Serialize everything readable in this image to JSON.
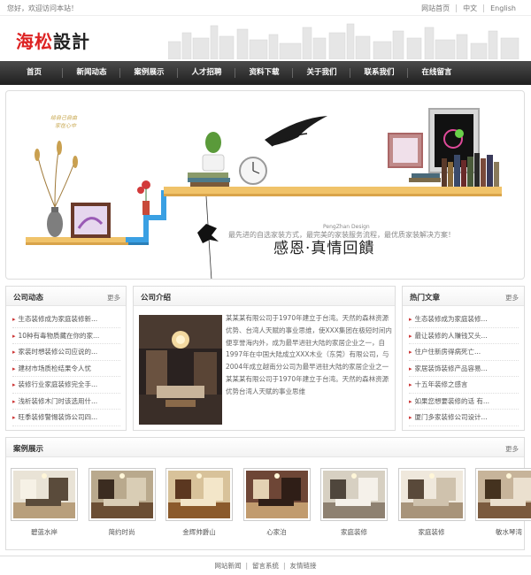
{
  "topbar": {
    "greeting": "您好，欢迎访问本站！",
    "links": [
      "网站首页",
      "中文",
      "English"
    ]
  },
  "logo": {
    "part1": "海松",
    "part2": "設計"
  },
  "nav": [
    "首页",
    "新闻动态",
    "案例展示",
    "人才招聘",
    "资料下载",
    "关于我们",
    "联系我们",
    "在线留言"
  ],
  "banner": {
    "slogan": "感恩·真情回饋",
    "slogan_en": "PengZhan Design",
    "tagline": "最先进的自选家装方式，最完美的家装服务流程，最优质家装解决方案！",
    "small_line1": "给自己自由",
    "small_line2": "家在心中"
  },
  "news": {
    "title": "公司动态",
    "more": "更多",
    "items": [
      "生态装修成为家庭装修新...",
      "10种有毒物质藏在你的家...",
      "家装时想装修公司应说的...",
      "建材市场质检结果令人忧",
      "装修行业家庭装修完全手...",
      "浅析装修木门时该选用什...",
      "旺季装修警惕装饰公司四..."
    ]
  },
  "about": {
    "title": "公司介绍",
    "text": "某某某有限公司于1970年建立于台湾。天然的森林资源优势、台湾人天赋的事业思维，使XXX集团在极短时间内便享誉海内外，成为最早进驻大陆的家居企业之一，自1997年在中国大陆成立XXX木业（东莞）有限公司，与2004年成立越南分公司为最早进驻大陆的家居企业之一某某某有限公司于1970年建立于台湾。天然的森林资源优势台湾人天赋的事业思维"
  },
  "hot": {
    "title": "热门文章",
    "more": "更多",
    "items": [
      "生态装修成为家庭装修...",
      "最让装修的人赚钱又头...",
      "住户住新房得病死亡...",
      "家居装饰装修产品容易...",
      "十五年装修之感言",
      "如果您想要装修的话 有...",
      "厦门多家装修公司设计..."
    ]
  },
  "cases": {
    "title": "案例展示",
    "more": "更多",
    "items": [
      {
        "caption": "碧蓝水岸",
        "palette": [
          "#e9e3d6",
          "#b89f7c",
          "#5a4b3b",
          "#f6f1e6"
        ]
      },
      {
        "caption": "简约时尚",
        "palette": [
          "#b9a98d",
          "#6b4e34",
          "#d9cdb5",
          "#3b2c20"
        ]
      },
      {
        "caption": "金辉帅爵山",
        "palette": [
          "#d8c29a",
          "#8b5a2b",
          "#f3e6c9",
          "#5b3720"
        ]
      },
      {
        "caption": "心家泊",
        "palette": [
          "#6e4636",
          "#c19b6e",
          "#2f1e17",
          "#e4d2b3"
        ]
      },
      {
        "caption": "家庭装修",
        "palette": [
          "#d7d0c2",
          "#8e8171",
          "#f5f1ea",
          "#4f463c"
        ]
      },
      {
        "caption": "家庭装修",
        "palette": [
          "#efe8dc",
          "#a8947a",
          "#cfc2ad",
          "#59493a"
        ]
      },
      {
        "caption": "敏水琴湾",
        "palette": [
          "#c7b49a",
          "#7b5a3e",
          "#ebe0cf",
          "#44321f"
        ]
      }
    ]
  },
  "footer": [
    "网站新闻",
    "留言系统",
    "友情链接"
  ]
}
